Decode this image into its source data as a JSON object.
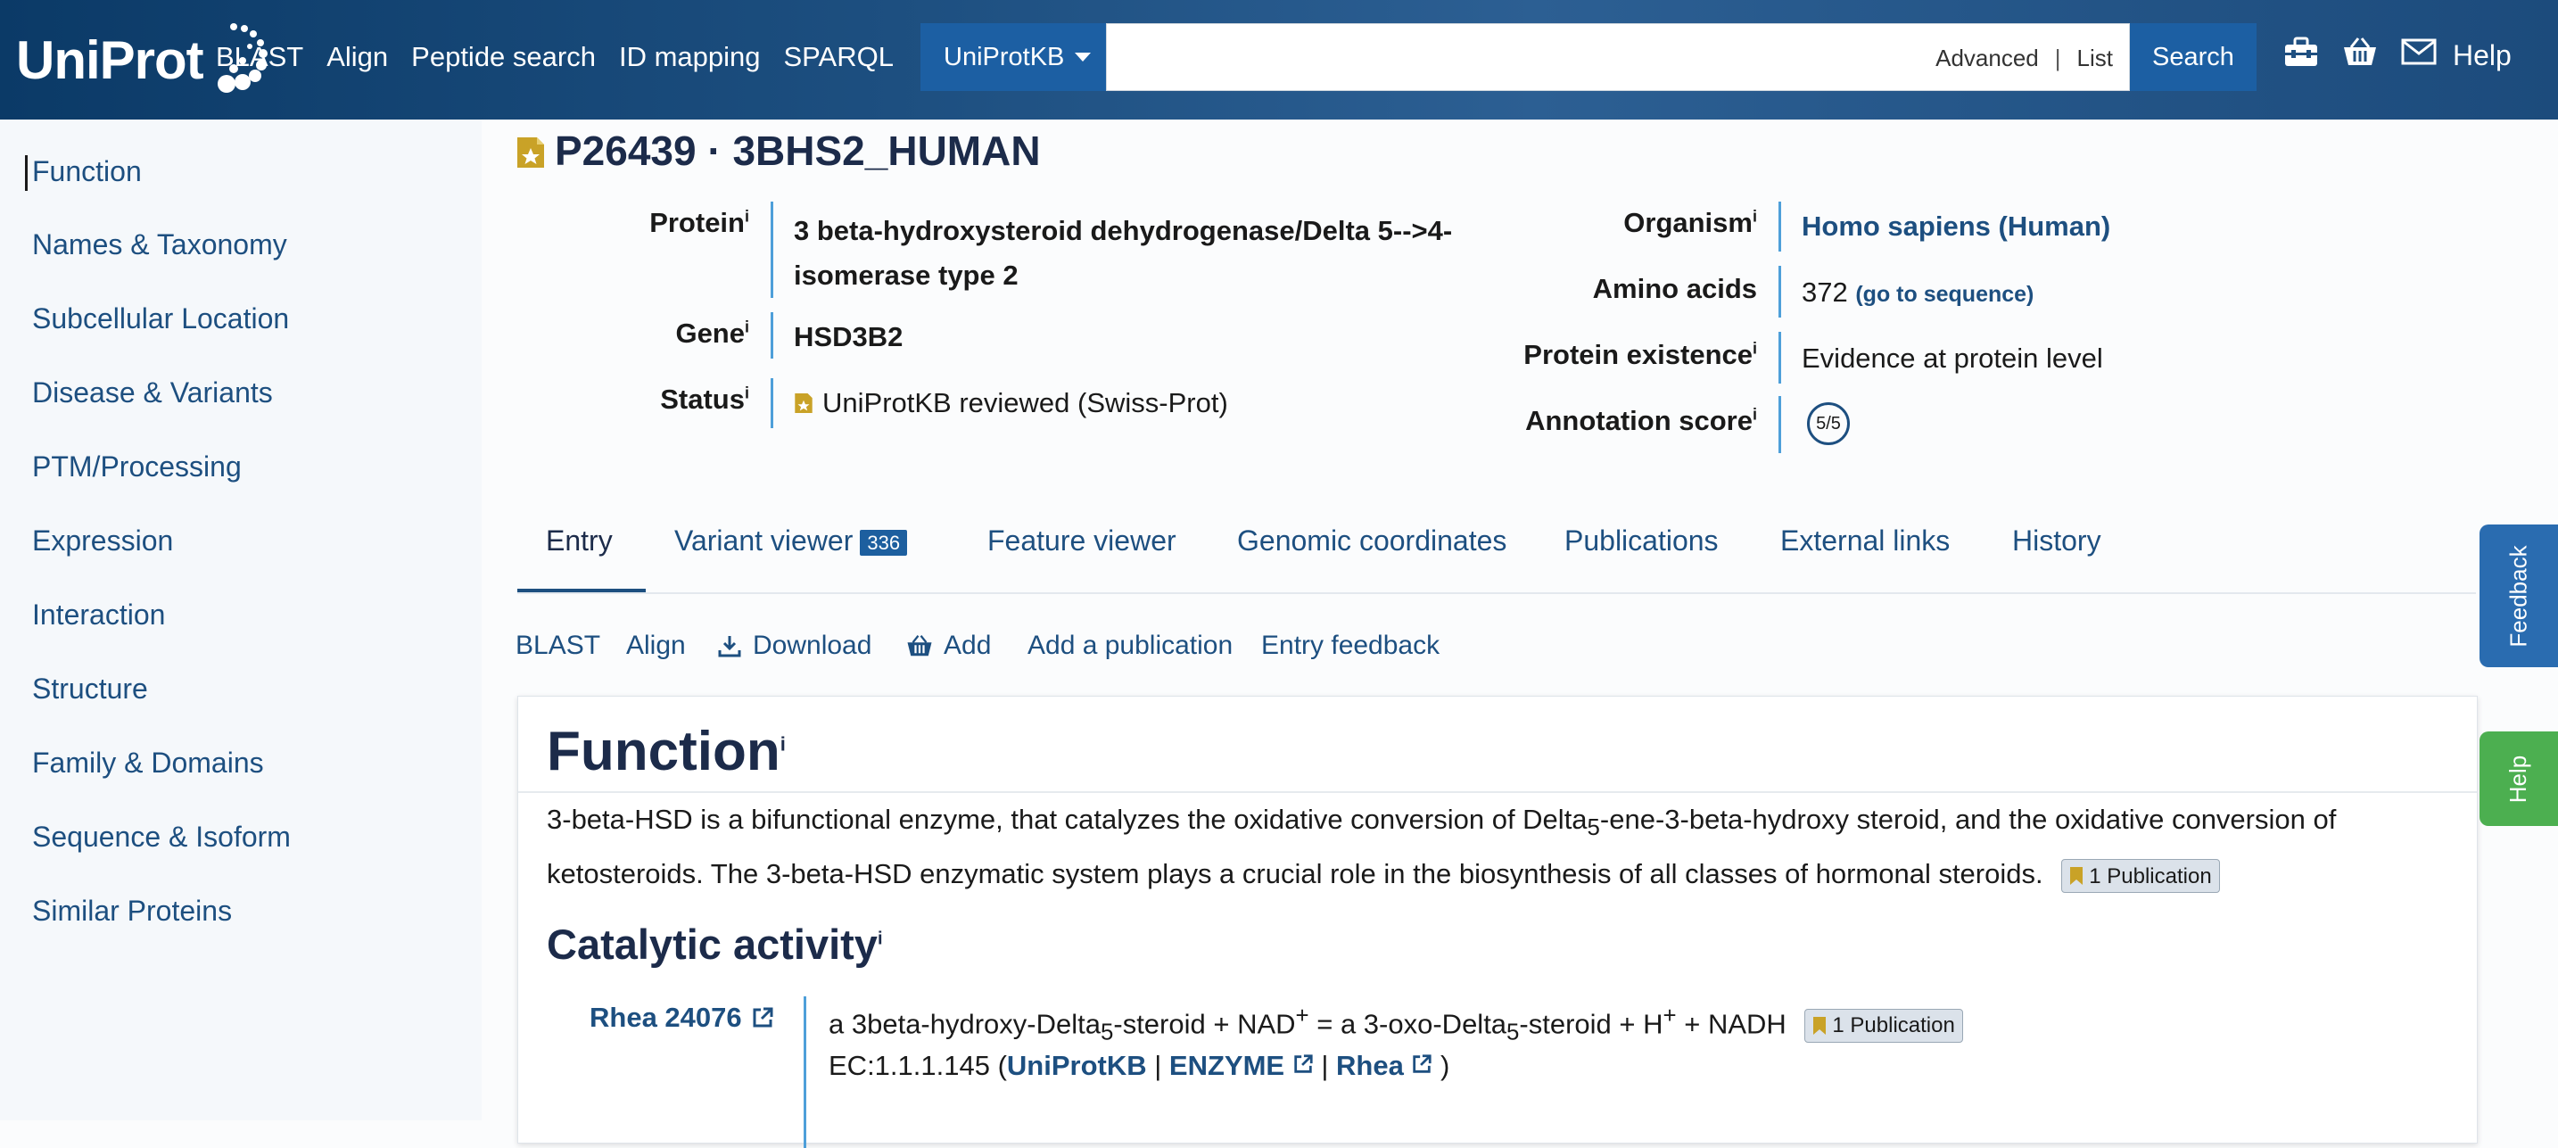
{
  "header": {
    "logo_text": "UniProt",
    "nav": [
      "BLAST",
      "Align",
      "Peptide search",
      "ID mapping",
      "SPARQL"
    ],
    "database": "UniProtKB",
    "search_placeholder": "",
    "advanced": "Advanced",
    "list": "List",
    "search_label": "Search",
    "help": "Help",
    "icons": [
      "tools-icon",
      "basket-icon",
      "mail-icon"
    ]
  },
  "sidebar": {
    "items": [
      "Function",
      "Names & Taxonomy",
      "Subcellular Location",
      "Disease & Variants",
      "PTM/Processing",
      "Expression",
      "Interaction",
      "Structure",
      "Family & Domains",
      "Sequence & Isoform",
      "Similar Proteins"
    ]
  },
  "entry": {
    "title": "P26439 · 3BHS2_HUMAN",
    "protein_label": "Protein",
    "protein_line1": "3 beta-hydroxysteroid dehydrogenase/Delta 5-->4-",
    "protein_line2": "isomerase type 2",
    "gene_label": "Gene",
    "gene": "HSD3B2",
    "status_label": "Status",
    "status": "UniProtKB reviewed (Swiss-Prot)",
    "organism_label": "Organism",
    "organism": "Homo sapiens (Human)",
    "amino_label": "Amino acids",
    "amino": "372",
    "goto_seq": "(go to sequence)",
    "existence_label": "Protein existence",
    "existence": "Evidence at protein level",
    "score_label": "Annotation score",
    "score": "5/5",
    "info_mark": "i"
  },
  "tabs": [
    {
      "label": "Entry"
    },
    {
      "label": "Variant viewer",
      "badge": "336"
    },
    {
      "label": "Feature viewer"
    },
    {
      "label": "Genomic coordinates"
    },
    {
      "label": "Publications"
    },
    {
      "label": "External links"
    },
    {
      "label": "History"
    }
  ],
  "toolbar": {
    "blast": "BLAST",
    "align": "Align",
    "download": "Download",
    "add": "Add",
    "add_publication": "Add a publication",
    "entry_feedback": "Entry feedback"
  },
  "function": {
    "title": "Function",
    "para_line1_a": "3-beta-HSD is a bifunctional enzyme, that catalyzes the oxidative conversion of Delta",
    "para_line1_sub": "5",
    "para_line1_b": "-ene-3-beta-hydroxy steroid, and the oxidative conversion of",
    "para_line2": "ketosteroids. The 3-beta-HSD enzymatic system plays a crucial role in the biosynthesis of all classes of hormonal steroids.",
    "pub_badge": "1 Publication",
    "catalytic_title": "Catalytic activity",
    "rhea_link": "Rhea 24076",
    "rxn_a": "a 3beta-hydroxy-Delta",
    "rxn_sub1": "5",
    "rxn_b": "-steroid + NAD",
    "rxn_sup1": "+",
    "rxn_c": " = a 3-oxo-Delta",
    "rxn_sub2": "5",
    "rxn_d": "-steroid + H",
    "rxn_sup2": "+",
    "rxn_e": " + NADH",
    "rxn_pub": "1 Publication",
    "ec_prefix": "EC:1.1.1.145 (",
    "ec_uniprot": "UniProtKB",
    "ec_sep1": " | ",
    "ec_enzyme": "ENZYME",
    "ec_sep2": " | ",
    "ec_rhea": "Rhea",
    "ec_suffix": " )"
  },
  "side_tabs": {
    "feedback": "Feedback",
    "help": "Help",
    "feedback_color": "#2a6cb0",
    "help_color": "#4caf50"
  }
}
